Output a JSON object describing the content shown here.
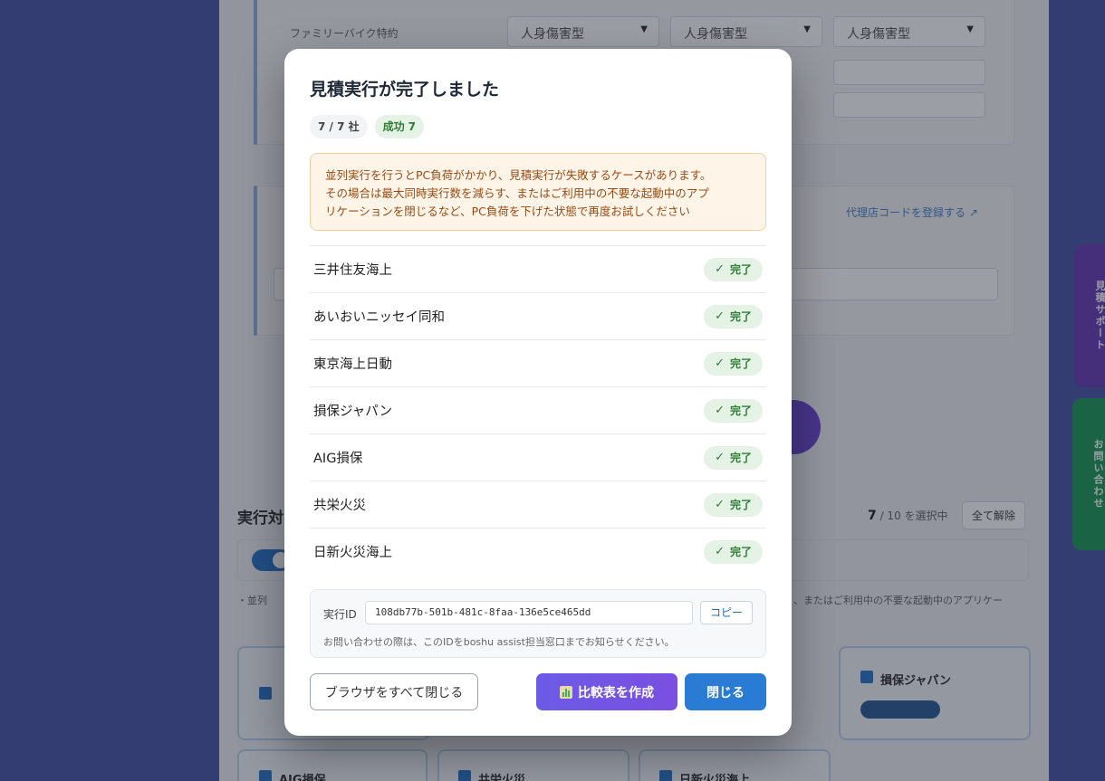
{
  "background": {
    "row_label": "ファミリーバイク特約",
    "select_value": "人身傷害型",
    "link_text": "代理店コードを登録する ↗",
    "section_heading": "実行対",
    "selected_count": "7",
    "selected_suffix": "/ 10 を選択中",
    "clear_button": "全て解除",
    "note_text": "・並列",
    "note_text_right": "、またはご利用中の不要な起動中のアプリケー",
    "company_cards": [
      "損保ジャパン",
      "AIG損保",
      "共栄火災",
      "日新火災海上"
    ],
    "side_tab_1": "見積サポート",
    "side_tab_2": "お問い合わせ"
  },
  "modal": {
    "title": "見積実行が完了しました",
    "count_chip": "7 / 7 社",
    "success_label": "成功",
    "success_count": "7",
    "warning_line1": "並列実行を行うとPC負荷がかかり、見積実行が失敗するケースがあります。",
    "warning_line2": "その場合は最大同時実行数を減らす、またはご利用中の不要な起動中のアプ",
    "warning_line3": "リケーションを閉じるなど、PC負荷を下げた状態で再度お試しください",
    "companies": [
      {
        "name": "三井住友海上",
        "status": "完了"
      },
      {
        "name": "あいおいニッセイ同和",
        "status": "完了"
      },
      {
        "name": "東京海上日動",
        "status": "完了"
      },
      {
        "name": "損保ジャパン",
        "status": "完了"
      },
      {
        "name": "AIG損保",
        "status": "完了"
      },
      {
        "name": "共栄火災",
        "status": "完了"
      },
      {
        "name": "日新火災海上",
        "status": "完了"
      }
    ],
    "exec_label": "実行ID",
    "exec_id": "108db77b-501b-481c-8faa-136e5ce465dd",
    "copy_label": "コピー",
    "exec_note": "お問い合わせの際は、このIDをboshu assist担当窓口までお知らせください。",
    "close_all_label": "ブラウザをすべて閉じる",
    "compare_label": "比較表を作成",
    "close_label": "閉じる"
  },
  "colors": {
    "primary": "#2a7bd3",
    "compare": "#6b5be6",
    "success_bg": "#e4f3e6",
    "success_text": "#2e7d32",
    "warning_bg": "#fff4e8",
    "warning_text": "#9a4a12"
  }
}
